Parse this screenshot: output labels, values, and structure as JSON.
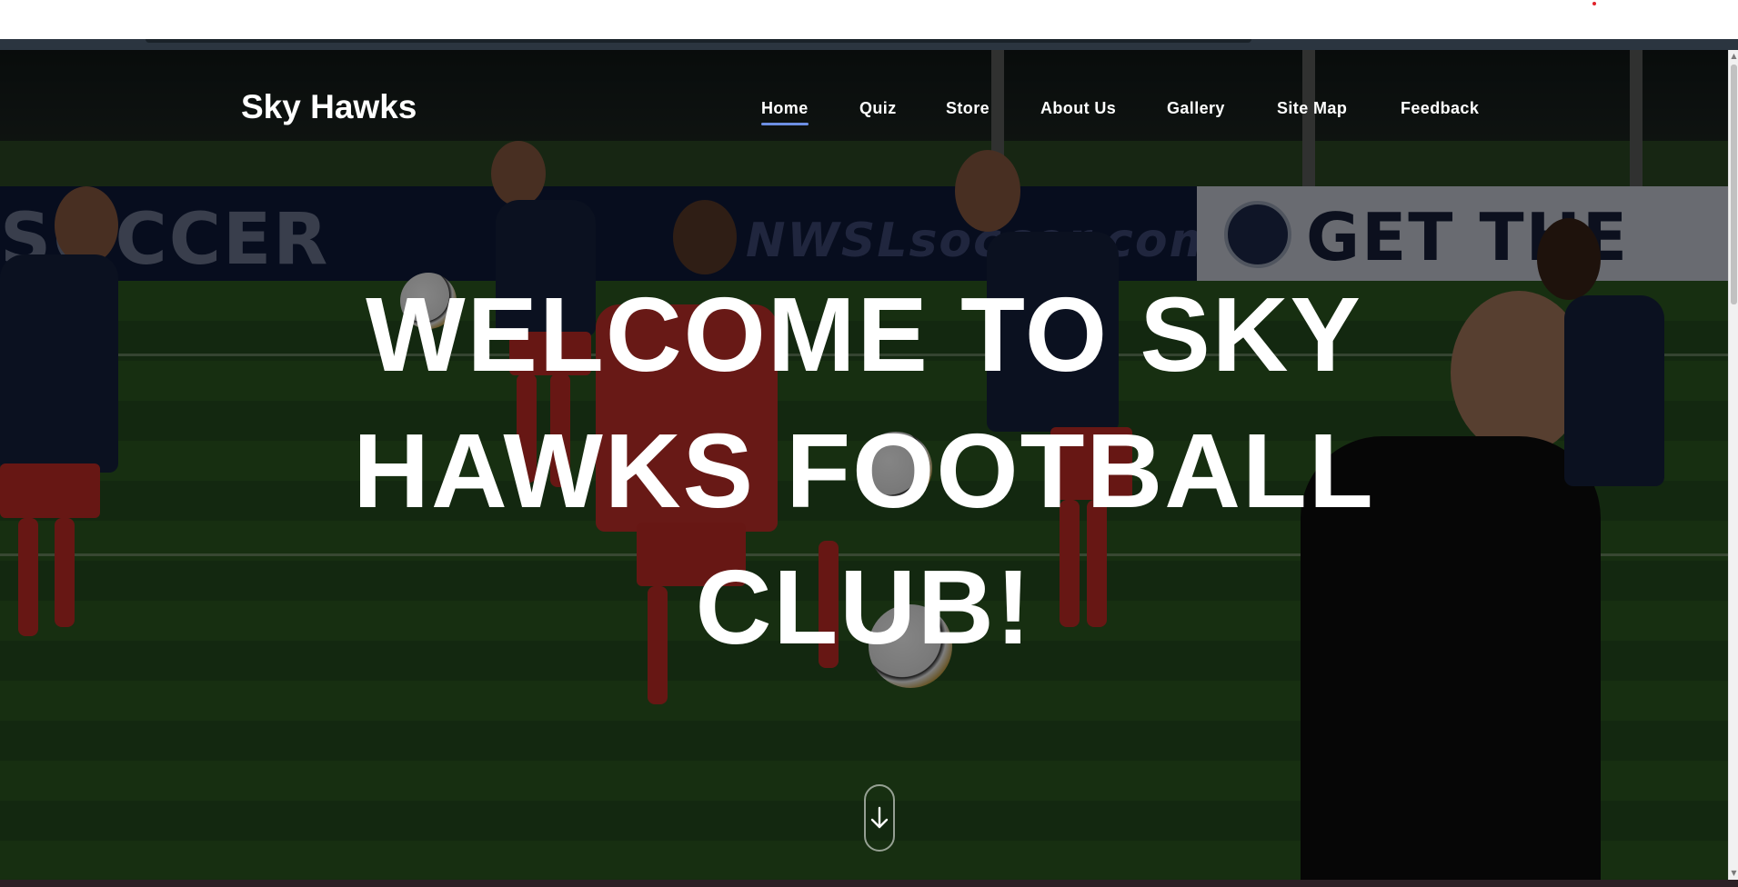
{
  "site": {
    "brand": "Sky Hawks"
  },
  "nav": {
    "items": [
      {
        "label": "Home",
        "active": true
      },
      {
        "label": "Quiz"
      },
      {
        "label": "Store"
      },
      {
        "label": "About Us"
      },
      {
        "label": "Gallery"
      },
      {
        "label": "Site Map"
      },
      {
        "label": "Feedback"
      }
    ]
  },
  "hero": {
    "headline_line1": "WELCOME TO SKY",
    "headline_line2": "HAWKS FOOTBALL",
    "headline_line3": "CLUB!",
    "background_text": {
      "left_banner_a": "SOCCER",
      "left_banner_b": "NWSLsoccer.com",
      "right_banner": "GET THE APP"
    },
    "scroll_icon": "arrow-down-icon"
  },
  "colors": {
    "nav_active_underline": "#6d8fe3",
    "text": "#ffffff",
    "overlay": "#000000"
  }
}
